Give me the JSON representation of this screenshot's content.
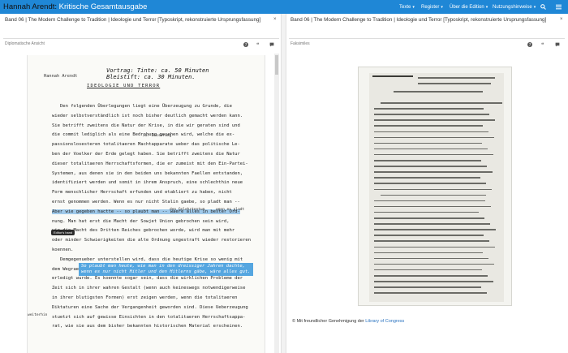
{
  "app": {
    "brand_owner": "Hannah Arendt:",
    "brand_name": "Kritische Gesamtausgabe"
  },
  "nav": {
    "items": [
      {
        "label": "Texte"
      },
      {
        "label": "Register"
      },
      {
        "label": "Über die Edition"
      },
      {
        "label": "Nutzungshinweise"
      }
    ],
    "caret": "▾"
  },
  "left_pane": {
    "title": "Band 06 | The Modern Challenge to Tradition | Ideologie und Terror [Typoskript, rekonstruierte Ursprungsfassung]",
    "view_label": "Diplomatische Ansicht",
    "close": "×"
  },
  "right_pane": {
    "title": "Band 06 | The Modern Challenge to Tradition | Ideologie und Terror [Typoskript, rekonstruierte Ursprungsfassung]",
    "view_label": "Faksimiles",
    "close": "×"
  },
  "document": {
    "author": "Hannah Arendt",
    "note1": "Vortrag: Tinte: ca. 50 Minuten",
    "note2": "Bleistift: ca. 30 Minuten.",
    "heading": "IDEOLOGIE UND TERROR",
    "tooltip": "Editor's hand",
    "annot1": "zur Besserung",
    "annot2": "den Gelehrtentum",
    "annot3": "wenn es pladt",
    "annot4": "weiterhin",
    "callout1": "So plaubt man heute, wie man in den dreissiger Jahren dachte,",
    "callout2": "wenn es nur nicht Hitler und den Hitlerns gäbe, wäre alles gut.",
    "lines": [
      {
        "n": "",
        "t": "Den folgenden Überlegungen liegt eine Überzeugung zu Grunde, die"
      },
      {
        "n": "",
        "t": "wieder selbstverständlich ist noch bisher deutlich gemacht werden kann."
      },
      {
        "n": "",
        "t": "Sie betrifft zweitens die Natur der Krise, in die wir geraten sind und"
      },
      {
        "n": "",
        "t": "die commit lediglich als eine Bedrohung gesehen wird, welche die ex-"
      },
      {
        "n": "5",
        "t": "passionslosesteren totalitaeren Machtapparate ueber das politische Le-"
      },
      {
        "n": "",
        "t": "ben der Voelker der Erde gelegt haben. Sie betrifft zweitens die Natur"
      },
      {
        "n": "",
        "t": "dieser totalitaeren Herrschaftsformen, die er zumeist mit den Ein-Partei-"
      },
      {
        "n": "",
        "t": "Systemen, aus denen sie in den beiden uns bekannten Faellen entstanden,"
      },
      {
        "n": "",
        "t": "identifiziert werden und somit in ihrem Anspruch, eine schlechthin neue"
      },
      {
        "n": "10",
        "t": "Form menschlicher Herrschaft erfunden und etabliert zu haben, nicht"
      },
      {
        "n": "",
        "t": "ernst genommen werden. Wenn es nur nicht Stalin gaebe, so pladt man --"
      },
      {
        "n": "",
        "t": "Aber wie gegeben hactte -- so plaubt man -- waere alles in bester Ord-"
      },
      {
        "n": "",
        "t": "nung. Man hat erst die Macht der Sowjet Union gebrochen sein wird,"
      },
      {
        "n": "",
        "t": "wie die Macht des Dritten Reiches gebrochen worde, wird man mit mehr"
      },
      {
        "n": "15",
        "t": "oder minder Schwierigkeiten die alte Ordnung ungestraft wieder restorieren"
      },
      {
        "n": "",
        "t": "koennen."
      },
      {
        "n": "",
        "t": "Demgegenueber unterstellen wird, dass die heutige Krise so wenig mit"
      },
      {
        "n": "",
        "t": "dem Wegraeumen Stalins erledigt sein wird wie sie nach dem Fall Hitlers"
      },
      {
        "n": "",
        "t": "erledigt wurde. Es koennte sogar sein, dass die wirklichen Probleme der"
      },
      {
        "n": "20",
        "t": "Zeit sich in ihrer wahren Gestalt (wenn auch keineswegs notwendigerweise"
      },
      {
        "n": "",
        "t": "in ihrer blutigsten Formen) erst zeigen werden, wenn die totalitaeren"
      },
      {
        "n": "",
        "t": "Diktaturen eine Sache der Vergangenheit geworden sind. Diese Ueberzeugung"
      },
      {
        "n": "",
        "t": "stuetzt sich auf gewisse Einsichten in den totalitaeren Herrschaftsappa-"
      },
      {
        "n": "",
        "t": "rat, wie sie aus dem bisher bekannten historischen Material erscheinen."
      }
    ]
  },
  "credit": {
    "prefix": "Mit freundlicher Genehmigung der",
    "link": "Library of Congress"
  },
  "colors": {
    "topbar": "#1f87d6",
    "highlight": "#9fc9ea",
    "callout": "#55a6e0",
    "link": "#2a73c0"
  }
}
